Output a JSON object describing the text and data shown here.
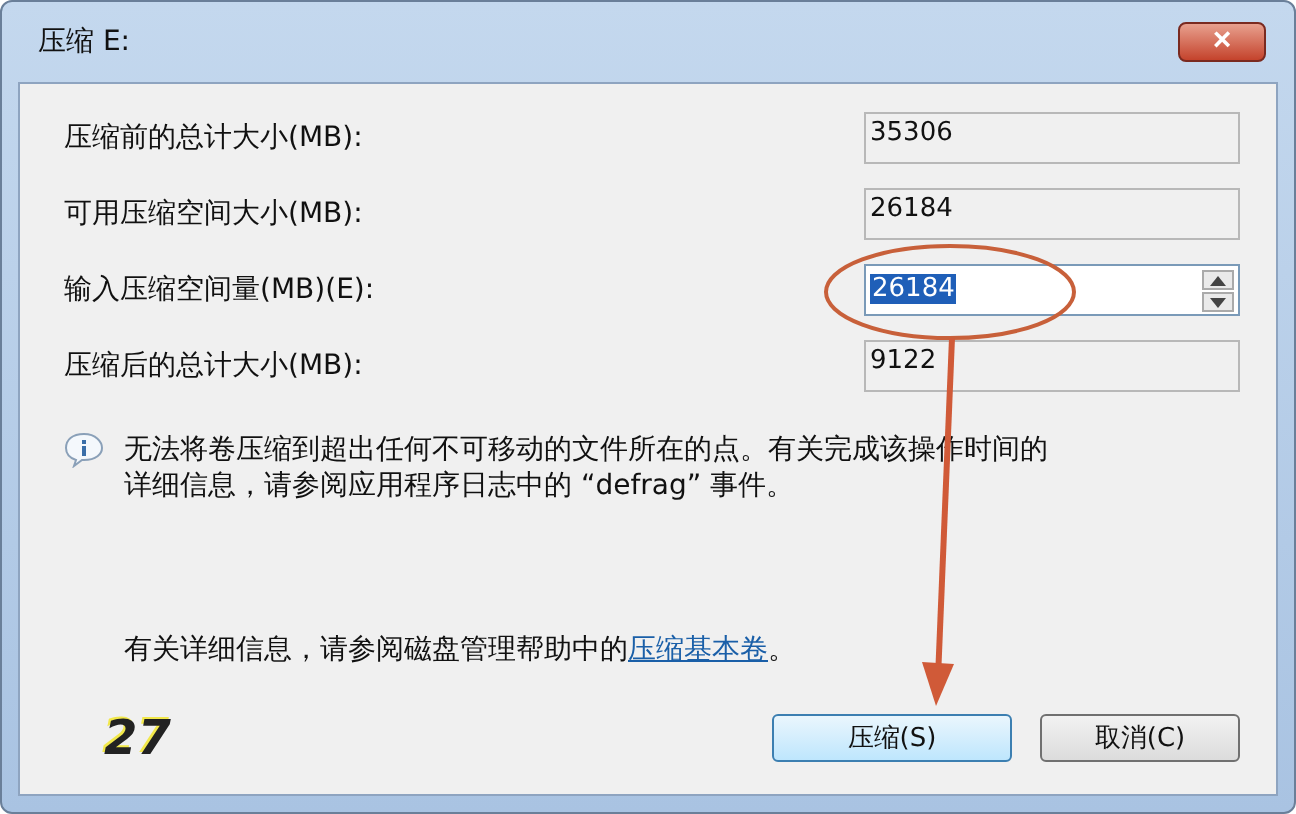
{
  "window": {
    "title": "压缩 E:",
    "close": "×"
  },
  "fields": [
    {
      "label": "压缩前的总计大小(MB):",
      "value": "35306",
      "kind": "readonly"
    },
    {
      "label": "可用压缩空间大小(MB):",
      "value": "26184",
      "kind": "readonly"
    },
    {
      "label": "输入压缩空间量(MB)(E):",
      "value": "26184",
      "kind": "spin"
    },
    {
      "label": "压缩后的总计大小(MB):",
      "value": "9122",
      "kind": "readonly"
    }
  ],
  "info": "无法将卷压缩到超出任何不可移动的文件所在的点。有关完成该操作时间的详细信息，请参阅应用程序日志中的 “defrag” 事件。",
  "help": {
    "text": "有关详细信息，请参阅磁盘管理帮助中的",
    "link": "压缩基本卷",
    "end": "。"
  },
  "step": "27",
  "buttons": [
    {
      "label": "压缩(S)",
      "selected": true
    },
    {
      "label": "取消(C)",
      "selected": false
    }
  ]
}
